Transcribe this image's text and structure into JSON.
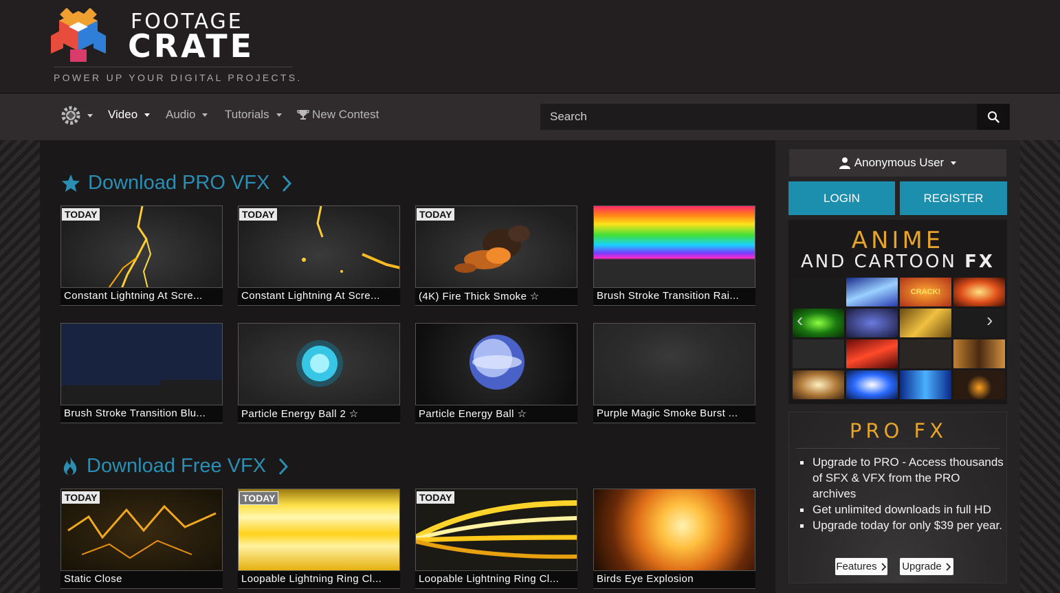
{
  "header": {
    "logo_line1": "FOOTAGE",
    "logo_line2": "CRATE",
    "tagline": "POWER UP YOUR DIGITAL PROJECTS."
  },
  "nav": {
    "items": [
      {
        "label": "Video",
        "active": true
      },
      {
        "label": "Audio",
        "active": false
      },
      {
        "label": "Tutorials",
        "active": false
      },
      {
        "label": "New Contest",
        "active": false
      }
    ],
    "search_placeholder": "Search"
  },
  "pro_section": {
    "title": "Download PRO VFX",
    "cards": [
      {
        "badge": "TODAY",
        "title": "Constant Lightning At Scre..."
      },
      {
        "badge": "TODAY",
        "title": "Constant Lightning At Scre..."
      },
      {
        "badge": "TODAY",
        "title": "(4K) Fire Thick Smoke ☆"
      },
      {
        "badge": "",
        "title": "Brush Stroke Transition Rai..."
      },
      {
        "badge": "",
        "title": "Brush Stroke Transition Blu..."
      },
      {
        "badge": "",
        "title": "Particle Energy Ball 2 ☆"
      },
      {
        "badge": "",
        "title": "Particle Energy Ball ☆"
      },
      {
        "badge": "",
        "title": "Purple Magic Smoke Burst ..."
      }
    ]
  },
  "free_section": {
    "title": "Download Free VFX",
    "cards": [
      {
        "badge": "TODAY",
        "title": "Static Close"
      },
      {
        "badge": "TODAY",
        "title": "Loopable Lightning Ring Cl..."
      },
      {
        "badge": "TODAY",
        "title": "Loopable Lightning Ring Cl..."
      },
      {
        "badge": "",
        "title": "Birds Eye Explosion"
      }
    ]
  },
  "sidebar": {
    "user_label": "Anonymous User",
    "login_label": "LOGIN",
    "register_label": "REGISTER",
    "ad": {
      "line1": "ANIME",
      "line2_a": "AND CARTOON ",
      "line2_b": "FX",
      "tile_text": "CRACK!"
    },
    "pro_box": {
      "title": "PRO FX",
      "bullets": [
        "Upgrade to PRO - Access thousands of SFX & VFX from the PRO archives",
        "Get unlimited downloads in full HD",
        "Upgrade today for only $39 per year."
      ],
      "features_label": "Features",
      "upgrade_label": "Upgrade"
    }
  },
  "colors": {
    "accent_blue": "#2a8fb3",
    "button_blue": "#1d8fae",
    "gold": "#e8a42a"
  }
}
